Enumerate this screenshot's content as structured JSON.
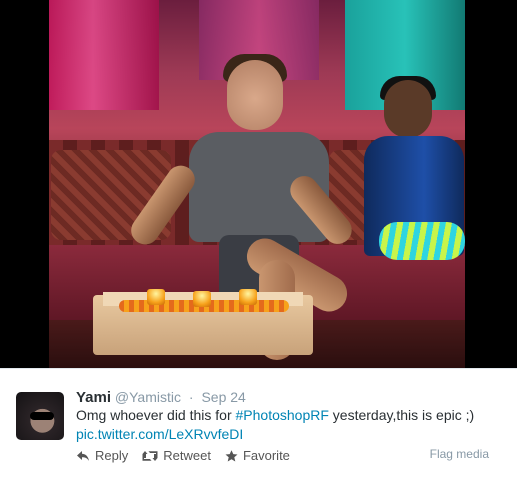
{
  "tweet": {
    "name": "Yami",
    "handle": "@Yamistic",
    "separator": "·",
    "date": "Sep 24",
    "text_before": "Omg whoever did this for ",
    "hashtag": "#PhotoshopRF",
    "text_after": " yesterday,this is epic ;)",
    "link": "pic.twitter.com/LeXRvvfeDI"
  },
  "actions": {
    "reply": "Reply",
    "retweet": "Retweet",
    "favorite": "Favorite",
    "flag_media": "Flag media"
  },
  "icons": {
    "reply": "reply-arrow-icon",
    "retweet": "retweet-icon",
    "favorite": "star-icon"
  },
  "colors": {
    "link": "#0084b4",
    "muted": "#8899a6",
    "text": "#292f33"
  }
}
